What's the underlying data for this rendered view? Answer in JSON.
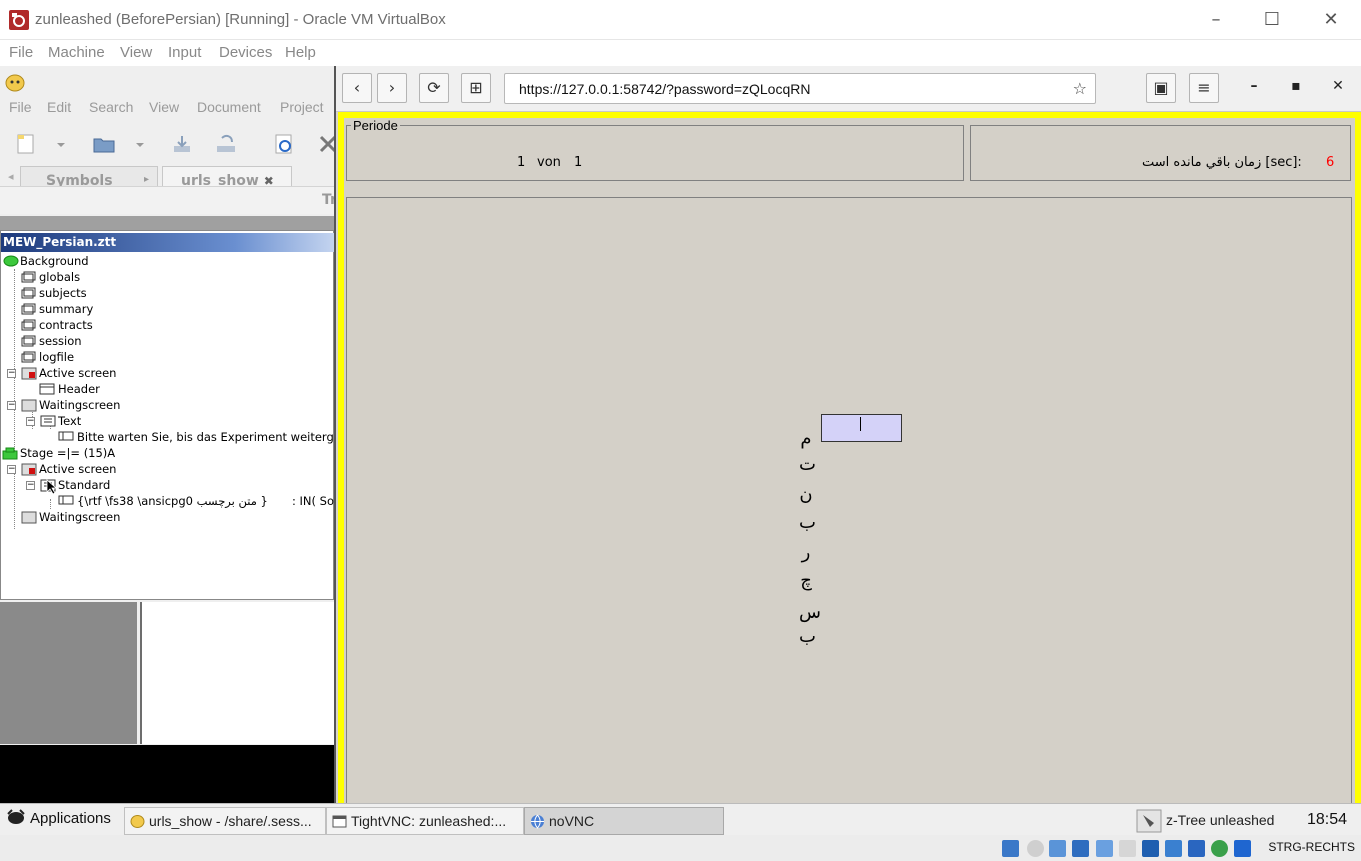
{
  "host": {
    "title": "zunleashed (BeforePersian) [Running] - Oracle VM VirtualBox",
    "menu": [
      "File",
      "Machine",
      "View",
      "Input",
      "Devices",
      "Help"
    ],
    "minimize": "–",
    "maximize": "☐",
    "close": "✕"
  },
  "ztree": {
    "menu": [
      "File",
      "Edit",
      "Search",
      "View",
      "Document",
      "Project"
    ],
    "tabs": [
      "Symbols",
      "urls_show"
    ],
    "tab_close": "✖",
    "tabrow2_text": "Tr",
    "doc_title": "MEW_Persian.ztt",
    "tree": {
      "background": "Background",
      "globals": "globals",
      "subjects": "subjects",
      "summary": "summary",
      "contracts": "contracts",
      "session": "session",
      "logfile": "logfile",
      "active_screen_1": "Active screen",
      "header": "Header",
      "waitingscreen_1": "Waitingscreen",
      "text": "Text",
      "bitte": "Bitte warten Sie, bis das Experiment weitergeht.",
      "stage": "Stage =|= (15)A",
      "active_screen_2": "Active screen",
      "standard": "Standard",
      "rtf_item": "{\\rtf \\fs38 \\ansicpg0 متن برچسب }",
      "rtf_suffix": ": IN( So",
      "waitingscreen_2": "Waitingscreen"
    }
  },
  "browser": {
    "back": "‹",
    "forward": "›",
    "reload": "⟳",
    "new_tab": "⊞",
    "url": "https://127.0.0.1:58742/?password=zQLocqRN",
    "star": "☆",
    "library": "▣",
    "menu": "≡",
    "minimize": "–",
    "maximize": "▪",
    "close": "✕"
  },
  "page": {
    "periode_label": "Periode",
    "periode_current": "1",
    "periode_von": "von",
    "periode_total": "1",
    "remaining_label": "زمان باقي مانده است [sec]:",
    "remaining_value": "6",
    "vertical_chars": [
      "م",
      "ت",
      "ن",
      "ب",
      "ر",
      "چ",
      "س",
      "ب"
    ]
  },
  "taskbar": {
    "applications": "Applications",
    "tasks": [
      {
        "label": "urls_show - /share/.sess..."
      },
      {
        "label": "TightVNC: zunleashed:..."
      },
      {
        "label": "noVNC"
      }
    ],
    "ztree_label": "z-Tree unleashed",
    "clock": "18:54"
  },
  "statusbar": {
    "hostkey": "STRG-RECHTS"
  },
  "colors": {
    "yellow_frame": "#ffff00",
    "panel_bg": "#d4d0c8",
    "input_bg": "#d4d2f8",
    "remaining_value": "#ff0000",
    "doc_title_bar": "#1d3a7c"
  }
}
